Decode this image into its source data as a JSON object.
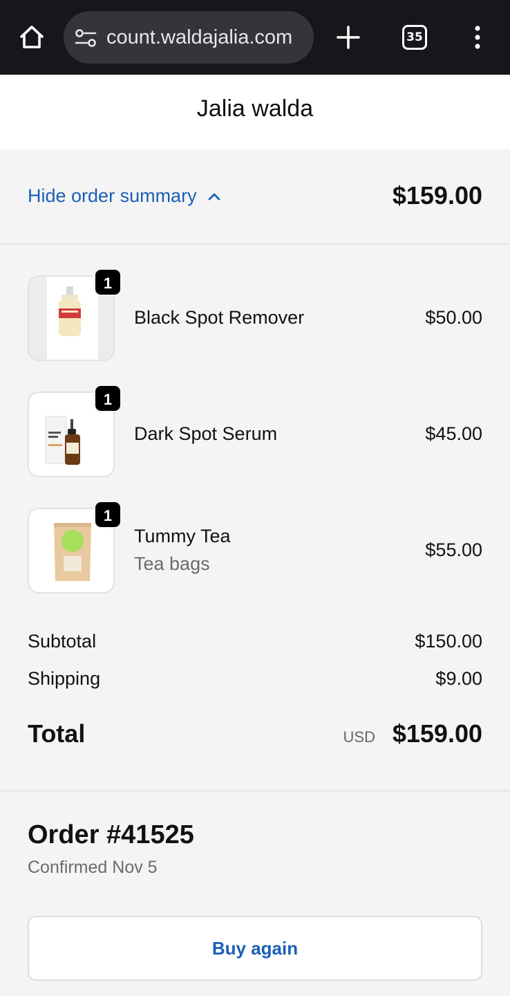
{
  "browser": {
    "url": "count.waldajalia.com",
    "tab_count": "35"
  },
  "store": {
    "name": "Jalia walda"
  },
  "summary": {
    "toggle_label": "Hide order summary",
    "total": "$159.00"
  },
  "items": [
    {
      "name": "Black Spot Remover",
      "variant": "",
      "price": "$50.00",
      "quantity": "1"
    },
    {
      "name": "Dark Spot Serum",
      "variant": "",
      "price": "$45.00",
      "quantity": "1"
    },
    {
      "name": "Tummy Tea",
      "variant": "Tea bags",
      "price": "$55.00",
      "quantity": "1"
    }
  ],
  "totals": {
    "subtotal_label": "Subtotal",
    "subtotal": "$150.00",
    "shipping_label": "Shipping",
    "shipping": "$9.00",
    "total_label": "Total",
    "currency": "USD",
    "total": "$159.00"
  },
  "order": {
    "number": "Order #41525",
    "status": "Confirmed Nov 5",
    "buy_again_label": "Buy again"
  },
  "colors": {
    "link": "#1a5fb4",
    "browser_bar": "#16171b"
  }
}
